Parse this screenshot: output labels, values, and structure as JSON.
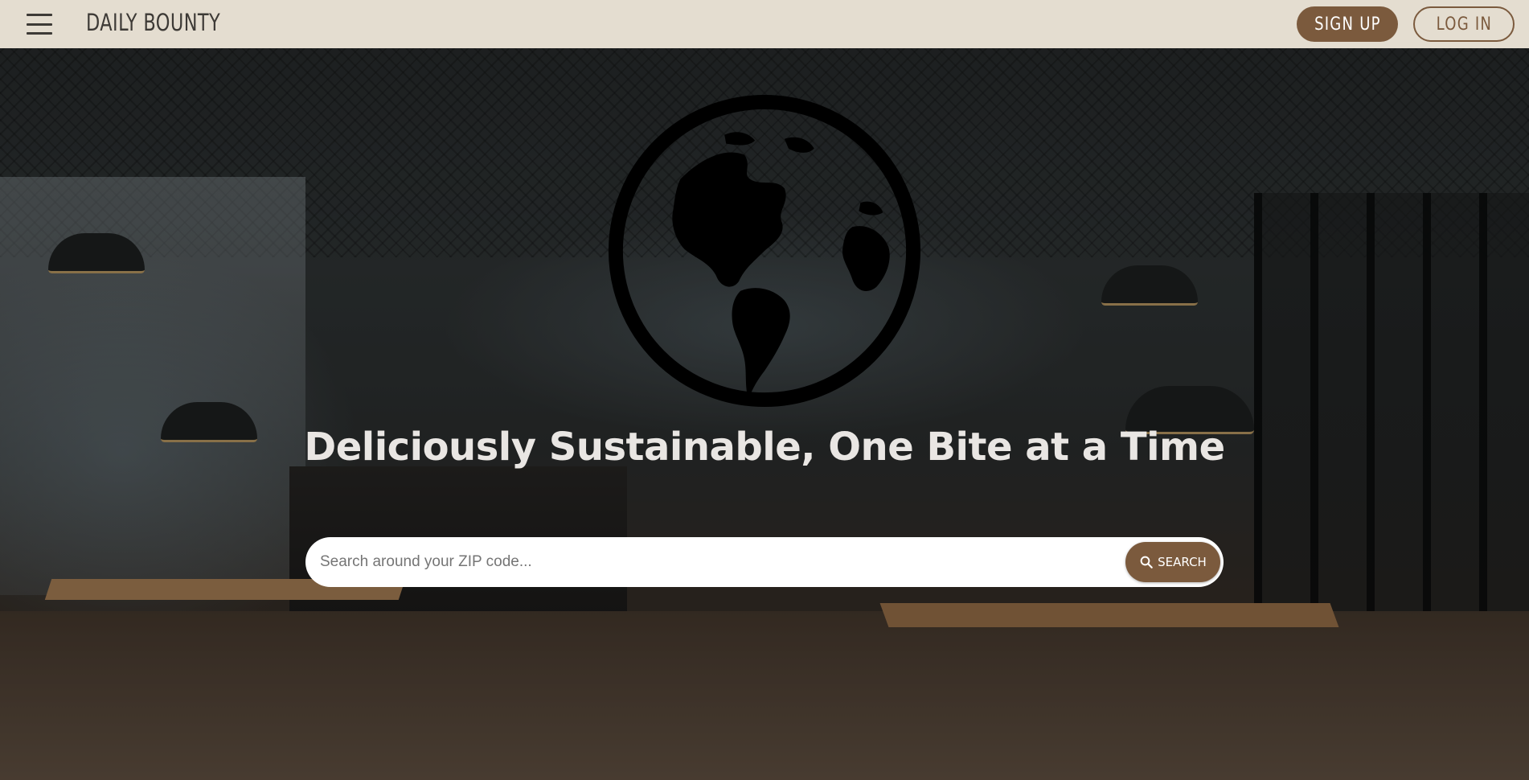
{
  "navbar": {
    "brand": "DAILY BOUNTY",
    "signup_label": "SIGN UP",
    "login_label": "LOG IN",
    "menu_icon": "hamburger-menu-icon"
  },
  "hero": {
    "icon": "globe-icon",
    "title": "Deliciously Sustainable, One Bite at a Time",
    "search": {
      "placeholder": "Search around your ZIP code...",
      "value": "",
      "button_label": "SEARCH",
      "button_icon": "search-icon"
    }
  },
  "colors": {
    "navbar_bg": "#e4ddd0",
    "accent_brown": "#7b5a3d",
    "brand_text": "#3d3a36",
    "hero_title": "#e9e6e3"
  }
}
